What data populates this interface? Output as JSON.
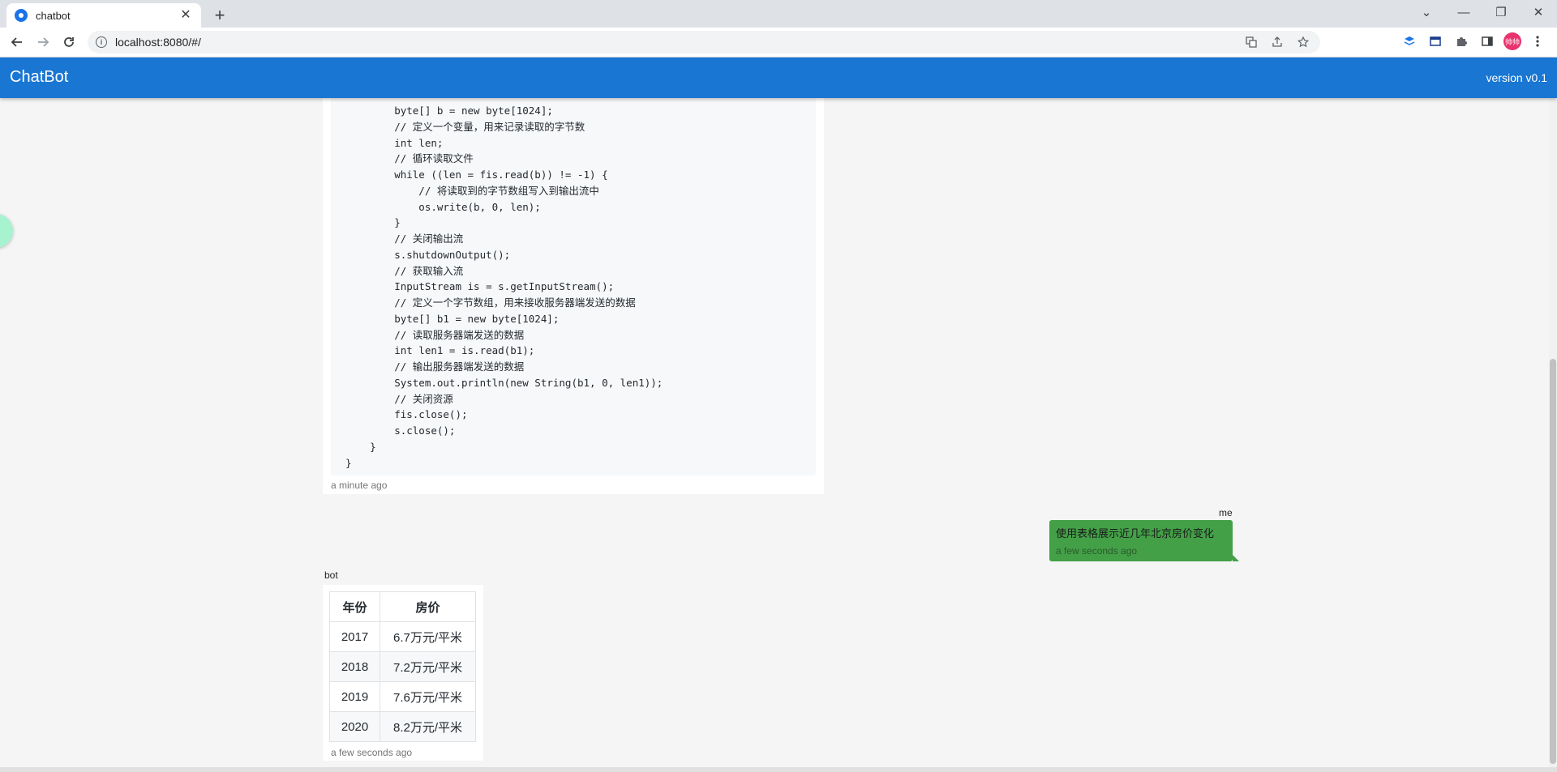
{
  "browser": {
    "tab_title": "chatbot",
    "tab_close": "✕",
    "new_tab": "+",
    "url": "localhost:8080/#/",
    "avatar_text": "帅帅",
    "window_controls": {
      "tabsearch": "⌄",
      "minimize": "—",
      "restore": "❐",
      "close": "✕"
    }
  },
  "app": {
    "title": "ChatBot",
    "version": "version v0.1"
  },
  "code_message": {
    "lines": [
      "        byte[] b = new byte[1024];",
      "        // 定义一个变量，用来记录读取的字节数",
      "        int len;",
      "        // 循环读取文件",
      "        while ((len = fis.read(b)) != -1) {",
      "            // 将读取到的字节数组写入到输出流中",
      "            os.write(b, 0, len);",
      "        }",
      "        // 关闭输出流",
      "        s.shutdownOutput();",
      "        // 获取输入流",
      "        InputStream is = s.getInputStream();",
      "        // 定义一个字节数组，用来接收服务器端发送的数据",
      "        byte[] b1 = new byte[1024];",
      "        // 读取服务器端发送的数据",
      "        int len1 = is.read(b1);",
      "        // 输出服务器端发送的数据",
      "        System.out.println(new String(b1, 0, len1));",
      "        // 关闭资源",
      "        fis.close();",
      "        s.close();",
      "    }",
      "}"
    ],
    "timestamp": "a minute ago"
  },
  "user_message": {
    "sender": "me",
    "text": "使用表格展示近几年北京房价变化",
    "timestamp": "a few seconds ago",
    "bubble_color": "#43a047"
  },
  "bot_message": {
    "sender": "bot",
    "table": {
      "headers": [
        "年份",
        "房价"
      ],
      "rows": [
        [
          "2017",
          "6.7万元/平米"
        ],
        [
          "2018",
          "7.2万元/平米"
        ],
        [
          "2019",
          "7.6万元/平米"
        ],
        [
          "2020",
          "8.2万元/平米"
        ]
      ]
    },
    "timestamp": "a few seconds ago"
  },
  "colors": {
    "appbar": "#1976d2",
    "page_background": "#f5f5f5"
  }
}
